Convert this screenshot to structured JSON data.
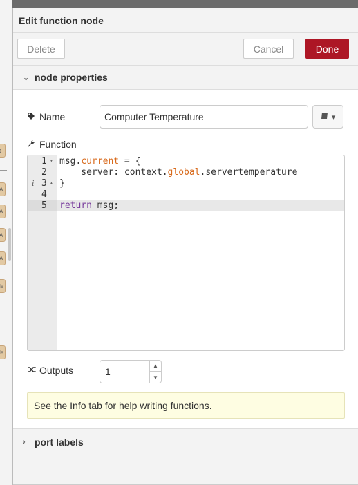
{
  "header": {
    "title": "Edit function node"
  },
  "toolbar": {
    "delete_label": "Delete",
    "cancel_label": "Cancel",
    "done_label": "Done"
  },
  "sections": {
    "node_properties": "node properties",
    "port_labels": "port labels"
  },
  "name_field": {
    "label": "Name",
    "value": "Computer Temperature"
  },
  "function": {
    "label": "Function",
    "lines": [
      {
        "number": "1",
        "fold": "▾",
        "info": ""
      },
      {
        "number": "2",
        "fold": "",
        "info": ""
      },
      {
        "number": "3",
        "fold": "▴",
        "info": "i"
      },
      {
        "number": "4",
        "fold": "",
        "info": ""
      },
      {
        "number": "5",
        "fold": "",
        "info": ""
      }
    ],
    "code": {
      "l1_a": "msg.",
      "l1_b": "current",
      "l1_c": " = {",
      "l2_a": "    server: context.",
      "l2_b": "global",
      "l2_c": ".servertemperature",
      "l3": "}",
      "l5_a": "return",
      "l5_b": " msg;"
    }
  },
  "outputs": {
    "label": "Outputs",
    "value": "1"
  },
  "hint": {
    "text": "See the Info tab for help writing functions."
  },
  "canvas": {
    "chips": [
      "t",
      "A",
      "A",
      "A",
      "A",
      "le",
      "le"
    ]
  },
  "colors": {
    "done": "#ad1625",
    "keyword_orange": "#d86a1c",
    "keyword_purple": "#7a3f9e",
    "hint_bg": "#fefde2"
  }
}
